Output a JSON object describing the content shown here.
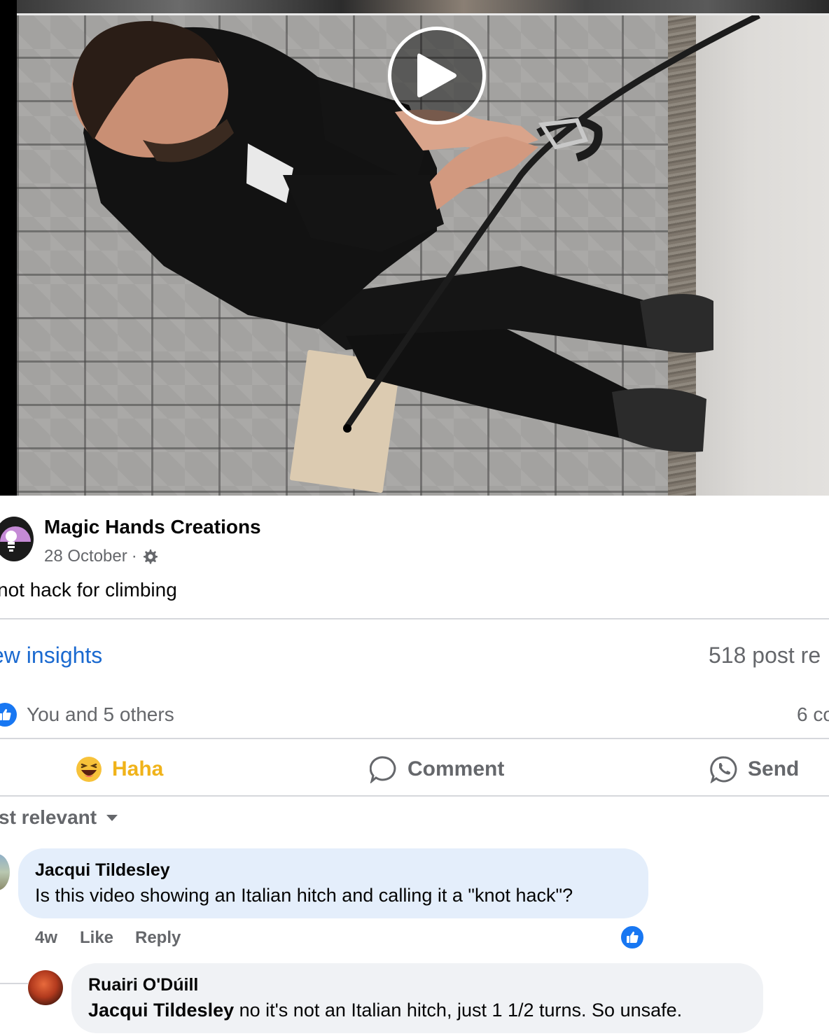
{
  "video": {
    "play_icon": "play-icon"
  },
  "post": {
    "page_name": "Magic Hands Creations",
    "date": "28 October",
    "separator": "·",
    "audience_icon": "gear-icon",
    "text": "not hack for climbing"
  },
  "stats": {
    "insights_link": "ew insights",
    "reach": "518 post re",
    "reactions": "You and 5 others",
    "comments_count": "6 co"
  },
  "actions": {
    "haha_label": "Haha",
    "comment_label": "Comment",
    "send_label": "Send"
  },
  "comments_section": {
    "sort_label": "st relevant"
  },
  "comments": [
    {
      "author": "Jacqui Tildesley",
      "text": "Is this video showing an Italian hitch and calling it a \"knot hack\"?",
      "time": "4w",
      "like_label": "Like",
      "reply_label": "Reply"
    },
    {
      "author": "Ruairi O'Dúill",
      "mention": "Jacqui Tildesley",
      "text": " no it's not an Italian hitch, just 1 1/2 turns. So unsafe."
    }
  ],
  "colors": {
    "link_blue": "#1b6ad0",
    "like_blue": "#1877f2",
    "haha_yellow": "#f0b31a",
    "muted_gray": "#65676b",
    "comment_bubble": "#e4eefb",
    "reply_bubble": "#f0f2f5"
  }
}
